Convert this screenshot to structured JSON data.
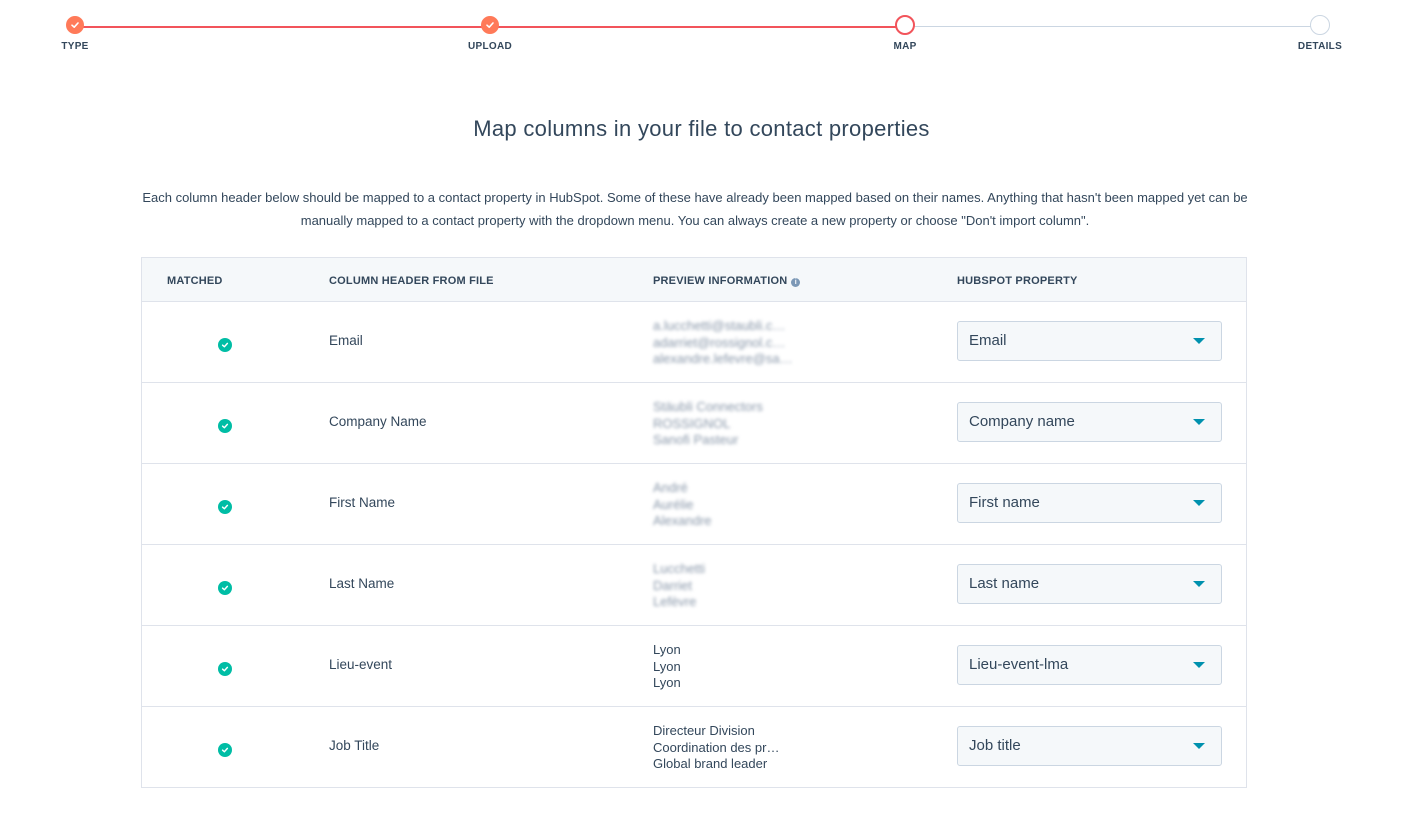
{
  "stepper": {
    "steps": [
      {
        "label": "TYPE",
        "state": "done"
      },
      {
        "label": "UPLOAD",
        "state": "done"
      },
      {
        "label": "MAP",
        "state": "current"
      },
      {
        "label": "DETAILS",
        "state": "todo"
      }
    ]
  },
  "page": {
    "title": "Map columns in your file to contact properties",
    "description": "Each column header below should be mapped to a contact property in HubSpot. Some of these have already been mapped based on their names. Anything that hasn't been mapped yet can be manually mapped to a contact property with the dropdown menu. You can always create a new property or choose \"Don't import column\"."
  },
  "table": {
    "headers": {
      "matched": "MATCHED",
      "column_header": "COLUMN HEADER FROM FILE",
      "preview": "PREVIEW INFORMATION",
      "property": "HUBSPOT PROPERTY"
    },
    "rows": [
      {
        "matched": true,
        "column": "Email",
        "preview": [
          "a.lucchetti@staubli.c…",
          "adarriet@rossignol.c…",
          "alexandre.lefevre@sa…"
        ],
        "preview_blurred": true,
        "property": "Email"
      },
      {
        "matched": true,
        "column": "Company Name",
        "preview": [
          "Stäubli Connectors",
          "ROSSIGNOL",
          "Sanofi Pasteur"
        ],
        "preview_blurred": true,
        "property": "Company name"
      },
      {
        "matched": true,
        "column": "First Name",
        "preview": [
          "André",
          "Aurélie",
          "Alexandre"
        ],
        "preview_blurred": true,
        "property": "First name"
      },
      {
        "matched": true,
        "column": "Last Name",
        "preview": [
          "Lucchetti",
          "Darriet",
          "Lefèvre"
        ],
        "preview_blurred": true,
        "property": "Last name"
      },
      {
        "matched": true,
        "column": "Lieu-event",
        "preview": [
          "Lyon",
          "Lyon",
          "Lyon"
        ],
        "preview_blurred": false,
        "property": "Lieu-event-lma"
      },
      {
        "matched": true,
        "column": "Job Title",
        "preview": [
          "Directeur Division",
          "Coordination des pr…",
          "Global brand leader"
        ],
        "preview_blurred": false,
        "property": "Job title"
      }
    ]
  },
  "colors": {
    "step_done": "#ff7a59",
    "step_line_done": "#f2545b",
    "step_todo": "#cbd6e2",
    "matched_check": "#00bda5",
    "dropdown_caret": "#0091ae",
    "text": "#33475b"
  }
}
